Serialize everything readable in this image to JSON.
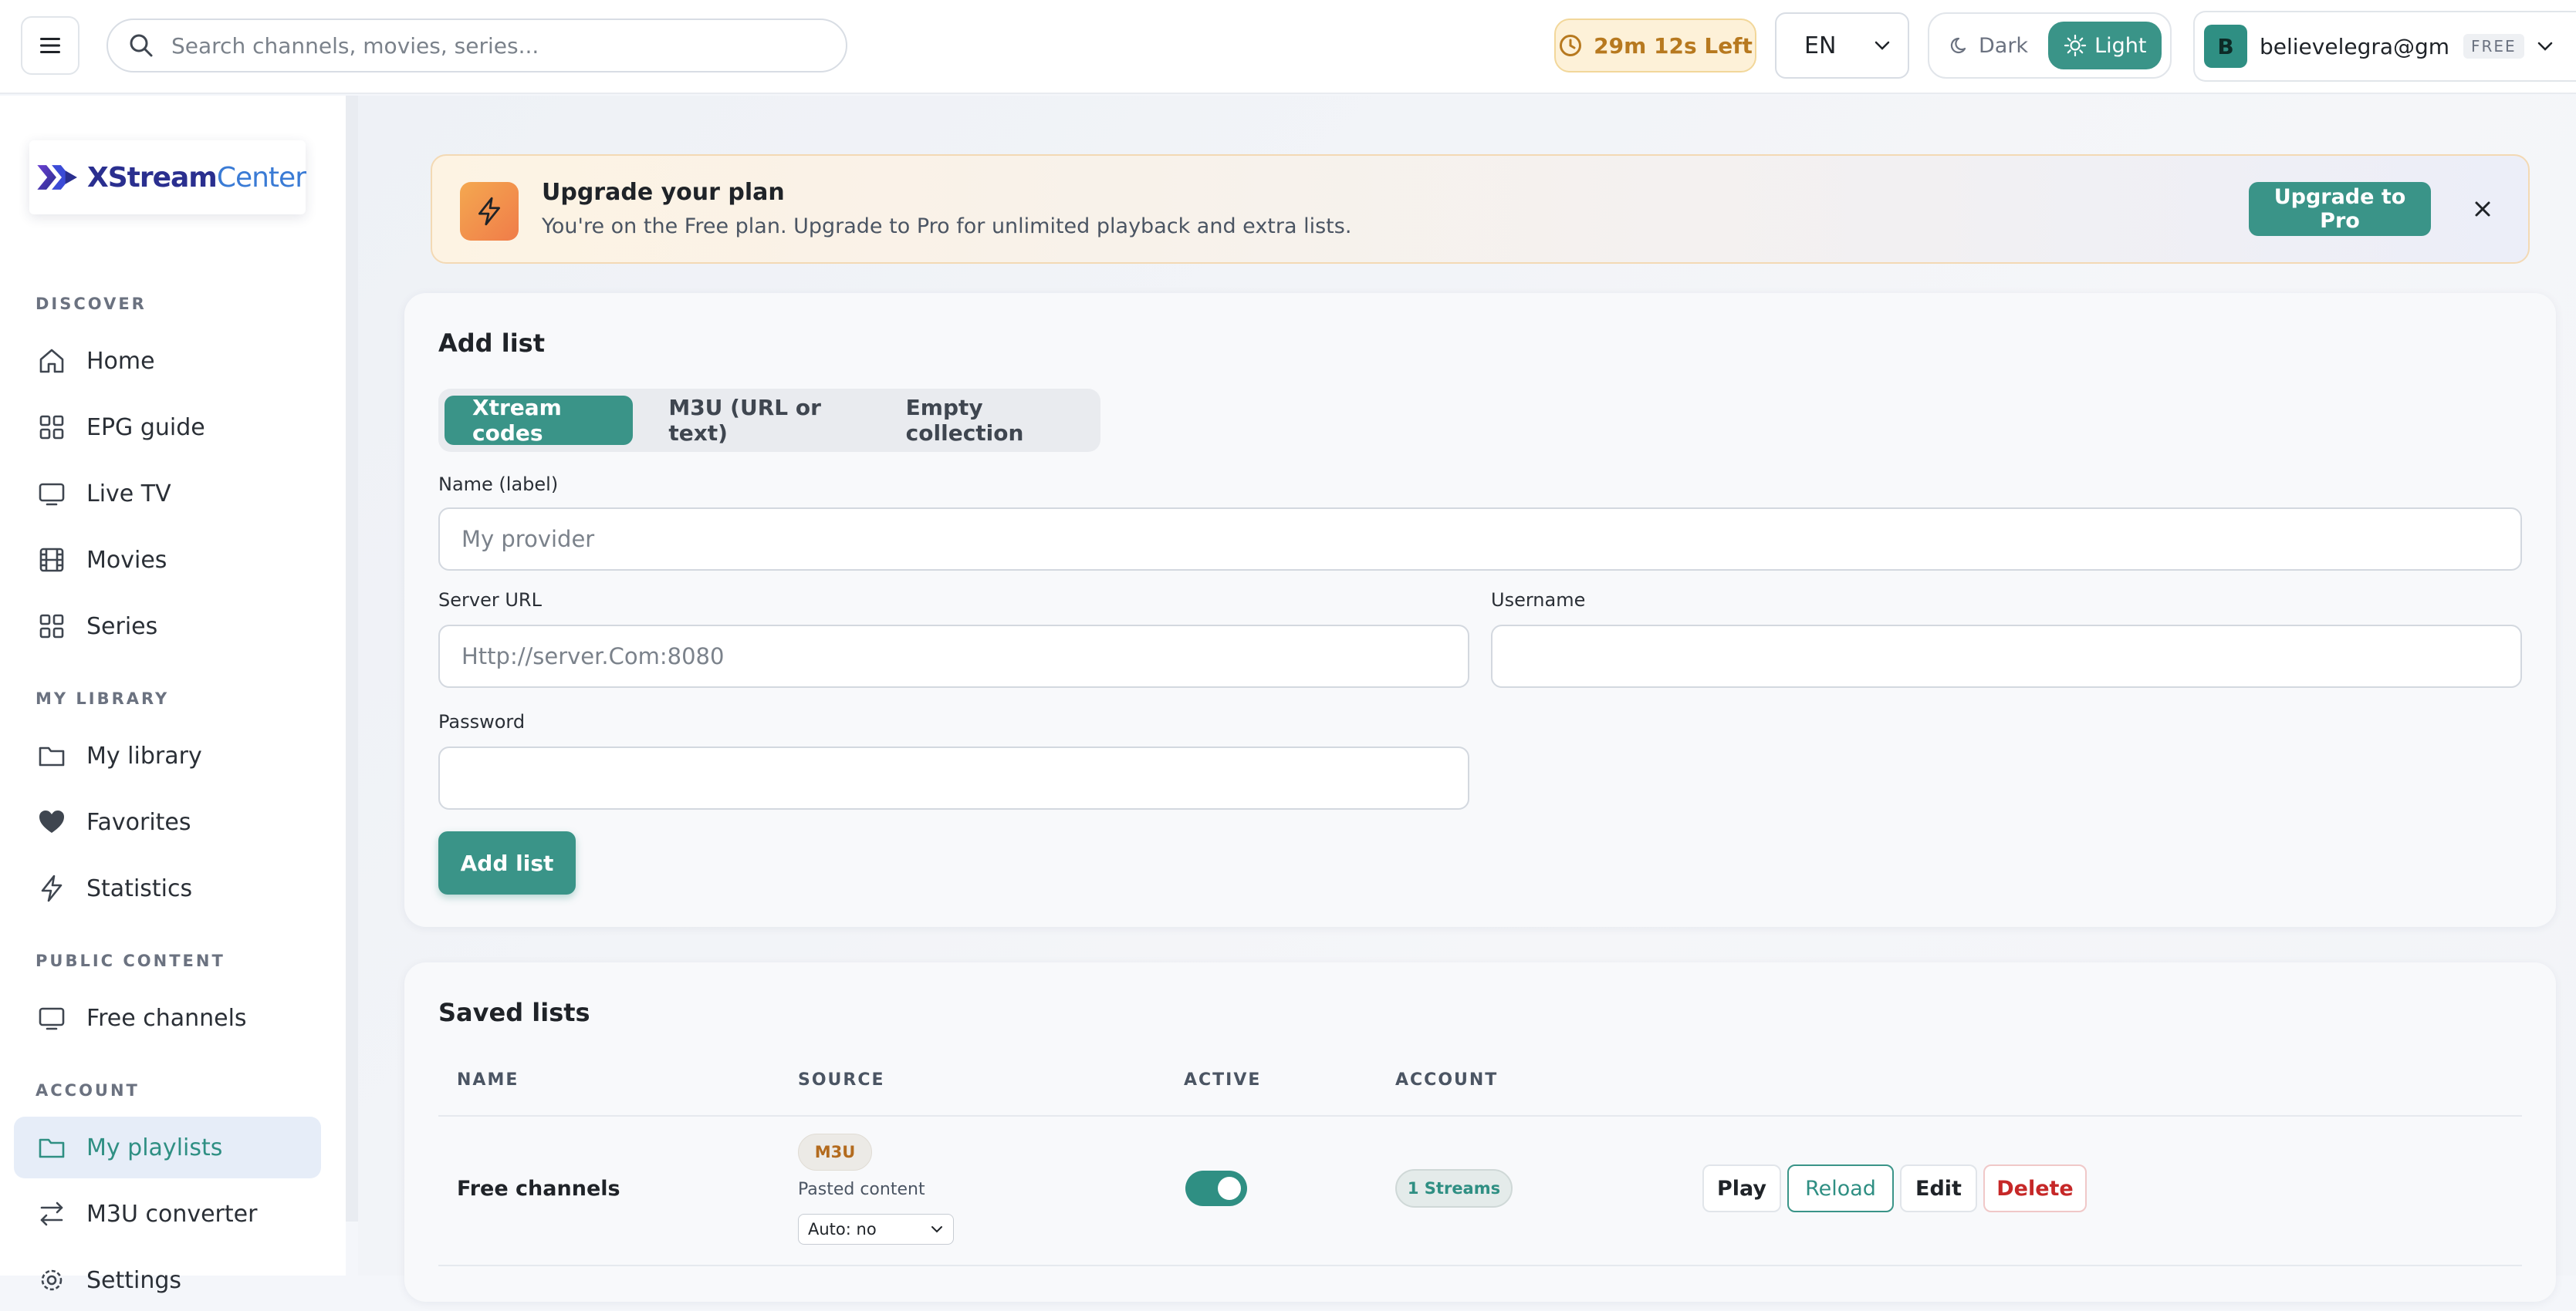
{
  "topbar": {
    "search_placeholder": "Search channels, movies, series...",
    "timer": "29m 12s Left",
    "language": "EN",
    "theme_dark": "Dark",
    "theme_light": "Light",
    "theme_selected": "Light",
    "avatar_initial": "B",
    "email": "believelegra@gm...",
    "plan_badge": "FREE"
  },
  "sidebar": {
    "logo_text_a": "XStream",
    "logo_text_b": "Center",
    "sections": {
      "discover": "DISCOVER",
      "my_library": "MY LIBRARY",
      "public_content": "PUBLIC CONTENT",
      "account": "ACCOUNT"
    },
    "items": {
      "home": "Home",
      "epg": "EPG guide",
      "live_tv": "Live TV",
      "movies": "Movies",
      "series": "Series",
      "my_library": "My library",
      "favorites": "Favorites",
      "statistics": "Statistics",
      "free_channels": "Free channels",
      "my_playlists": "My playlists",
      "m3u_converter": "M3U converter",
      "settings": "Settings"
    },
    "active_item": "My playlists"
  },
  "banner": {
    "title": "Upgrade your plan",
    "subtitle": "You're on the Free plan. Upgrade to Pro for unlimited playback and extra lists.",
    "button": "Upgrade to Pro"
  },
  "add_list": {
    "title": "Add list",
    "tabs": [
      "Xtream codes",
      "M3U (URL or text)",
      "Empty collection"
    ],
    "active_tab": "Xtream codes",
    "name_label": "Name (label)",
    "name_placeholder": "My provider",
    "server_label": "Server URL",
    "server_placeholder": "Http://server.Com:8080",
    "username_label": "Username",
    "username_value": "",
    "password_label": "Password",
    "password_value": "",
    "submit": "Add list"
  },
  "saved_lists": {
    "title": "Saved lists",
    "columns": [
      "NAME",
      "SOURCE",
      "ACTIVE",
      "ACCOUNT"
    ],
    "rows": [
      {
        "name": "Free channels",
        "source_type": "M3U",
        "source_detail": "Pasted content",
        "auto": "Auto: no",
        "active": true,
        "account": "1 Streams",
        "actions": [
          "Play",
          "Reload",
          "Edit",
          "Delete"
        ]
      }
    ]
  },
  "colors": {
    "accent": "#3a9488",
    "warning": "#b7791f",
    "danger": "#c62828"
  }
}
